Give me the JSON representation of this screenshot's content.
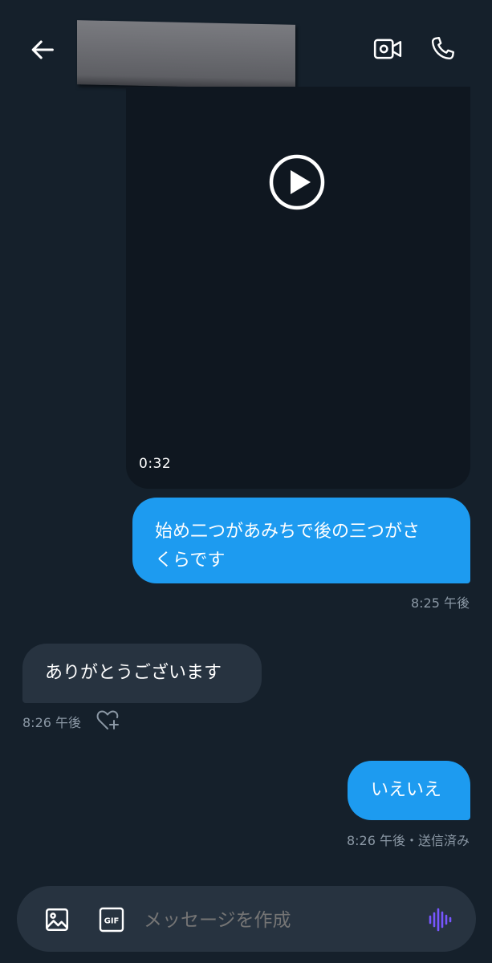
{
  "header": {
    "back_icon": "arrow-left-icon",
    "video_call_icon": "video-camera-icon",
    "phone_call_icon": "phone-icon",
    "icon_color": "#ffffff"
  },
  "video_message": {
    "duration": "0:32",
    "play_icon": "play-circle-icon"
  },
  "messages": [
    {
      "direction": "outgoing",
      "text_line1": "始め二つがあみちで後の三つがさ",
      "text_line2": "くらです",
      "time": "8:25 午後"
    },
    {
      "direction": "incoming",
      "text": "ありがとうございます",
      "time": "8:26 午後",
      "reaction_icon": "heart-plus-icon"
    },
    {
      "direction": "outgoing",
      "text": "いえいえ",
      "time": "8:26 午後・送信済み"
    }
  ],
  "composer": {
    "placeholder": "メッセージを作成",
    "image_icon": "image-icon",
    "gif_label": "GIF",
    "voice_icon": "voice-wave-icon"
  },
  "colors": {
    "background": "#15202b",
    "outgoing_bubble": "#1d9bf0",
    "incoming_bubble": "#273340",
    "meta_text": "#8b98a5",
    "voice_accent": "#7856ff"
  }
}
